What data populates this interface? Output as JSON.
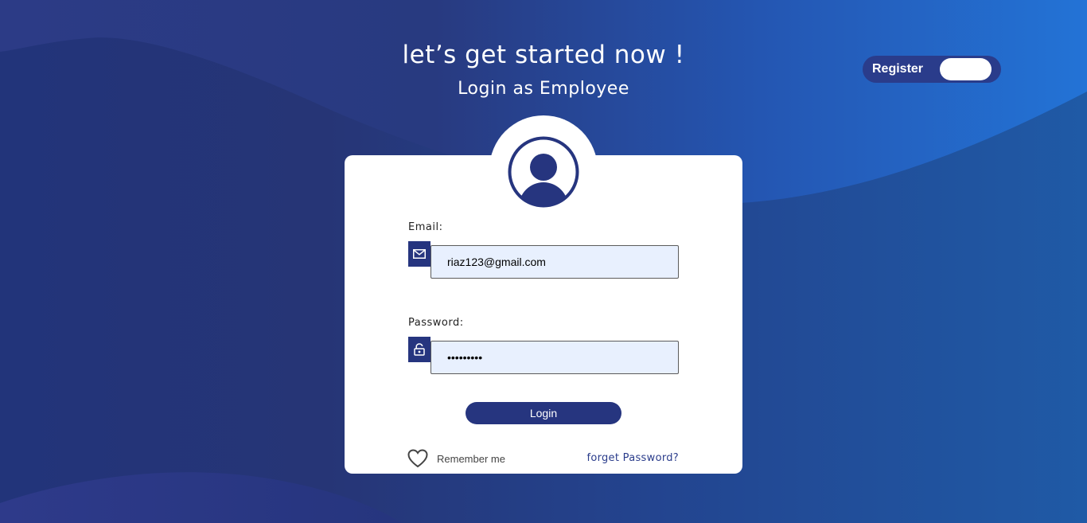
{
  "header": {
    "title": "let’s get started now !",
    "subtitle": "Login as Employee"
  },
  "register_toggle": {
    "label": "Register",
    "state": "off"
  },
  "login_form": {
    "email": {
      "label": "Email:",
      "value": "riaz123@gmail.com",
      "icon": "mail-icon"
    },
    "password": {
      "label": "Password:",
      "value": "•••••••••",
      "icon": "lock-icon"
    },
    "login_label": "Login",
    "remember_label": "Remember me",
    "remember_icon": "heart-icon",
    "forget_label": "forget Password?"
  },
  "avatar": {
    "icon": "user-avatar-icon"
  },
  "colors": {
    "primary": "#26357f",
    "input_bg": "#e8f0fe",
    "card_bg": "#ffffff",
    "background_left": "#22347a",
    "background_right": "#2270d1"
  }
}
